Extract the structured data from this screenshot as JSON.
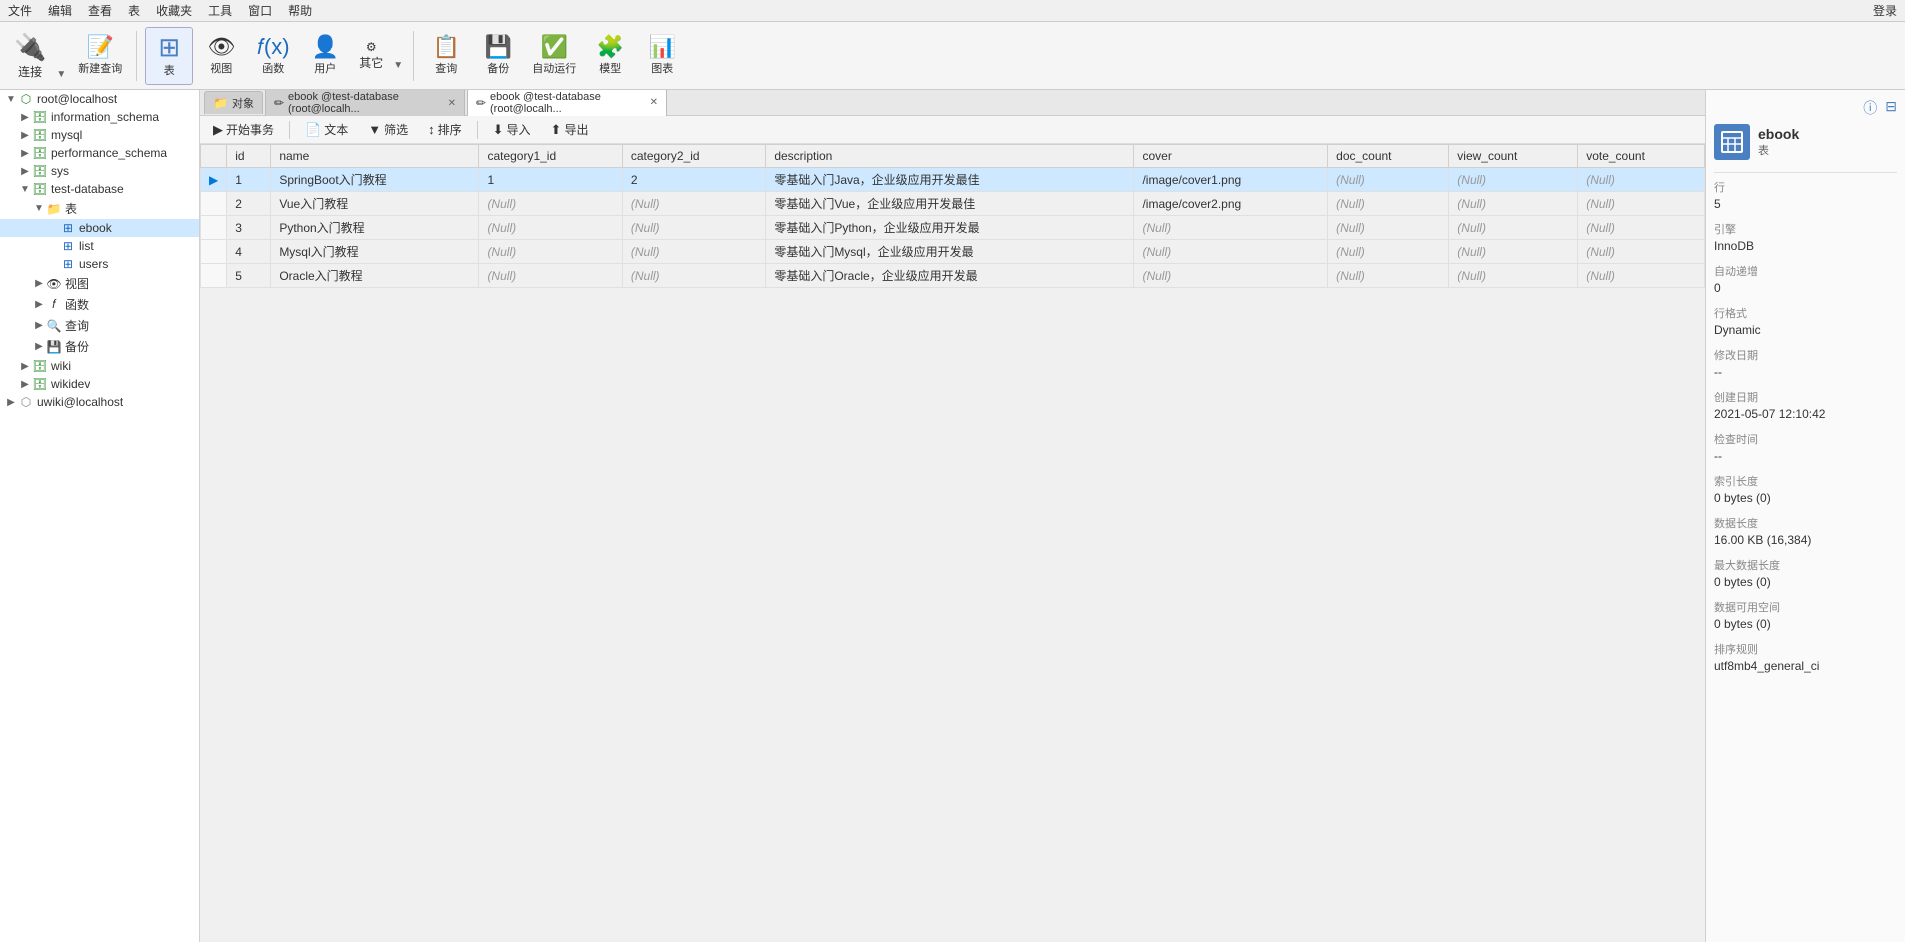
{
  "menubar": {
    "items": [
      "文件",
      "编辑",
      "查看",
      "表",
      "收藏夹",
      "工具",
      "窗口",
      "帮助"
    ],
    "login": "登录"
  },
  "toolbar": {
    "connect_label": "连接",
    "new_query_label": "新建查询",
    "table_label": "表",
    "view_label": "视图",
    "function_label": "函数",
    "user_label": "用户",
    "other_label": "其它",
    "query_label": "查询",
    "backup_label": "备份",
    "autorun_label": "自动运行",
    "model_label": "模型",
    "chart_label": "图表"
  },
  "tabs": [
    {
      "label": "对象",
      "active": false,
      "closable": false
    },
    {
      "label": "ebook @test-database (root@localh...",
      "active": false,
      "closable": true
    },
    {
      "label": "ebook @test-database (root@localh...",
      "active": true,
      "closable": true
    }
  ],
  "subtoolbar": {
    "begin_trans": "开始事务",
    "text": "文本",
    "filter": "筛选",
    "sort": "排序",
    "import": "导入",
    "export": "导出"
  },
  "sidebar": {
    "nodes": [
      {
        "id": "root_localhost",
        "label": "root@localhost",
        "level": 0,
        "expanded": true,
        "type": "connection"
      },
      {
        "id": "information_schema",
        "label": "information_schema",
        "level": 1,
        "expanded": false,
        "type": "database"
      },
      {
        "id": "mysql",
        "label": "mysql",
        "level": 1,
        "expanded": false,
        "type": "database"
      },
      {
        "id": "performance_schema",
        "label": "performance_schema",
        "level": 1,
        "expanded": false,
        "type": "database"
      },
      {
        "id": "sys",
        "label": "sys",
        "level": 1,
        "expanded": false,
        "type": "database"
      },
      {
        "id": "test_database",
        "label": "test-database",
        "level": 1,
        "expanded": true,
        "type": "database_active"
      },
      {
        "id": "tables_group",
        "label": "表",
        "level": 2,
        "expanded": true,
        "type": "group"
      },
      {
        "id": "ebook",
        "label": "ebook",
        "level": 3,
        "expanded": false,
        "type": "table",
        "selected": true
      },
      {
        "id": "list",
        "label": "list",
        "level": 3,
        "expanded": false,
        "type": "table"
      },
      {
        "id": "users",
        "label": "users",
        "level": 3,
        "expanded": false,
        "type": "table"
      },
      {
        "id": "views_group",
        "label": "视图",
        "level": 2,
        "expanded": false,
        "type": "group"
      },
      {
        "id": "functions_group",
        "label": "函数",
        "level": 2,
        "expanded": false,
        "type": "group"
      },
      {
        "id": "queries_group",
        "label": "查询",
        "level": 2,
        "expanded": false,
        "type": "group"
      },
      {
        "id": "backup_group",
        "label": "备份",
        "level": 2,
        "expanded": false,
        "type": "group"
      },
      {
        "id": "wiki",
        "label": "wiki",
        "level": 1,
        "expanded": false,
        "type": "database"
      },
      {
        "id": "wikidev",
        "label": "wikidev",
        "level": 1,
        "expanded": false,
        "type": "database"
      },
      {
        "id": "uwiki_localhost",
        "label": "uwiki@localhost",
        "level": 0,
        "expanded": false,
        "type": "connection"
      }
    ]
  },
  "table_data": {
    "columns": [
      "id",
      "name",
      "category1_id",
      "category2_id",
      "description",
      "cover",
      "doc_count",
      "view_count",
      "vote_count"
    ],
    "rows": [
      {
        "id": "1",
        "name": "SpringBoot入门教程",
        "category1_id": "1",
        "category2_id": "2",
        "description": "零基础入门Java，企业级应用开发最佳",
        "cover": "/image/cover1.png",
        "doc_count": "(Null)",
        "view_count": "(Null)",
        "vote_count": "(Null)"
      },
      {
        "id": "2",
        "name": "Vue入门教程",
        "category1_id": "(Null)",
        "category2_id": "(Null)",
        "description": "零基础入门Vue，企业级应用开发最佳",
        "cover": "/image/cover2.png",
        "doc_count": "(Null)",
        "view_count": "(Null)",
        "vote_count": "(Null)"
      },
      {
        "id": "3",
        "name": "Python入门教程",
        "category1_id": "(Null)",
        "category2_id": "(Null)",
        "description": "零基础入门Python，企业级应用开发最",
        "cover": "(Null)",
        "doc_count": "(Null)",
        "view_count": "(Null)",
        "vote_count": "(Null)"
      },
      {
        "id": "4",
        "name": "Mysql入门教程",
        "category1_id": "(Null)",
        "category2_id": "(Null)",
        "description": "零基础入门Mysql，企业级应用开发最",
        "cover": "(Null)",
        "doc_count": "(Null)",
        "view_count": "(Null)",
        "vote_count": "(Null)"
      },
      {
        "id": "5",
        "name": "Oracle入门教程",
        "category1_id": "(Null)",
        "category2_id": "(Null)",
        "description": "零基础入门Oracle，企业级应用开发最",
        "cover": "(Null)",
        "doc_count": "(Null)",
        "view_count": "(Null)",
        "vote_count": "(Null)"
      }
    ]
  },
  "right_panel": {
    "table_name": "ebook",
    "table_type": "表",
    "rows_label": "行",
    "rows_value": "5",
    "engine_label": "引擎",
    "engine_value": "InnoDB",
    "auto_inc_label": "自动递增",
    "auto_inc_value": "0",
    "row_format_label": "行格式",
    "row_format_value": "Dynamic",
    "modify_date_label": "修改日期",
    "modify_date_value": "--",
    "create_date_label": "创建日期",
    "create_date_value": "2021-05-07 12:10:42",
    "check_time_label": "检查时间",
    "check_time_value": "--",
    "index_length_label": "索引长度",
    "index_length_value": "0 bytes (0)",
    "data_length_label": "数据长度",
    "data_length_value": "16.00 KB (16,384)",
    "max_data_length_label": "最大数据长度",
    "max_data_length_value": "0 bytes (0)",
    "data_free_label": "数据可用空间",
    "data_free_value": "0 bytes (0)",
    "collation_label": "排序规则",
    "collation_value": "utf8mb4_general_ci"
  }
}
